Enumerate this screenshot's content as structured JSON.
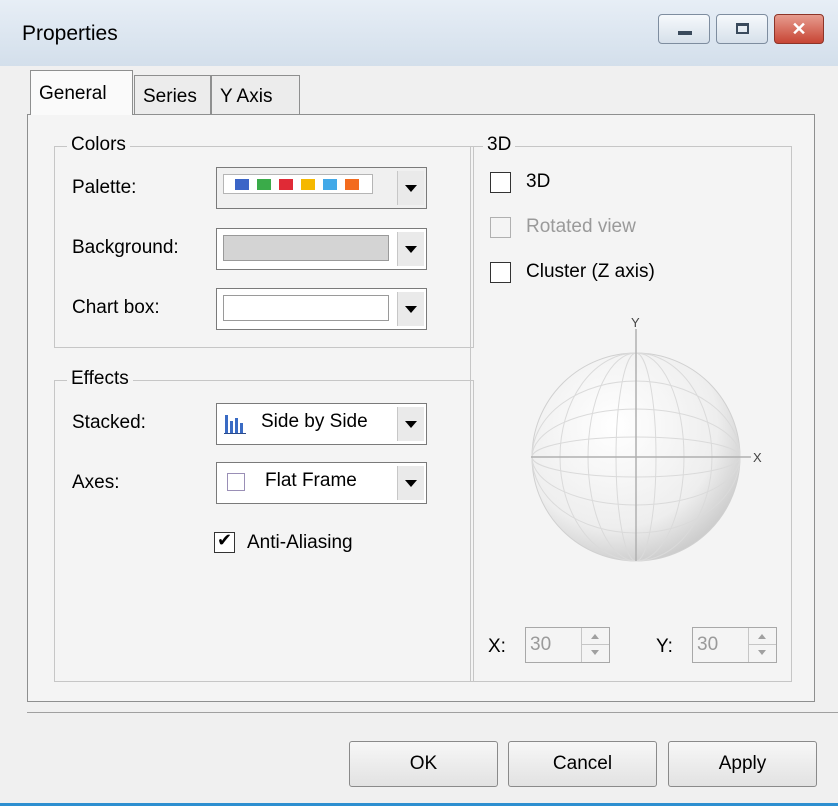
{
  "window": {
    "title": "Properties"
  },
  "titlebar_buttons": {
    "minimize_icon": "minimize-icon",
    "maximize_icon": "maximize-icon",
    "close_icon": "close-icon",
    "close_glyph": "✕"
  },
  "tabs": [
    {
      "label": "General",
      "active": true
    },
    {
      "label": "Series",
      "active": false
    },
    {
      "label": "Y Axis",
      "active": false
    }
  ],
  "colors_group": {
    "legend": "Colors",
    "palette_label": "Palette:",
    "palette_swatches": [
      "#3b65c7",
      "#3aab49",
      "#e02a36",
      "#f5b800",
      "#42a9e8",
      "#f36b1e"
    ],
    "background_label": "Background:",
    "background_color": "#d4d4d4",
    "chartbox_label": "Chart box:",
    "chartbox_color": "#ffffff"
  },
  "effects_group": {
    "legend": "Effects",
    "stacked_label": "Stacked:",
    "stacked_value": "Side by Side",
    "stacked_icon": "bar-chart-icon",
    "axes_label": "Axes:",
    "axes_value": "Flat Frame",
    "axes_icon": "flat-frame-icon",
    "antialias_label": "Anti-Aliasing",
    "antialias_checked": true
  },
  "three_d_group": {
    "legend": "3D",
    "option_3d_label": "3D",
    "option_3d_checked": false,
    "rotated_label": "Rotated view",
    "rotated_enabled": false,
    "cluster_label": "Cluster (Z axis)",
    "cluster_checked": false,
    "sphere_y_label": "Y",
    "sphere_x_label": "X",
    "x_label": "X:",
    "x_value": "30",
    "y_label": "Y:",
    "y_value": "30"
  },
  "buttons": {
    "ok": "OK",
    "cancel": "Cancel",
    "apply": "Apply"
  }
}
